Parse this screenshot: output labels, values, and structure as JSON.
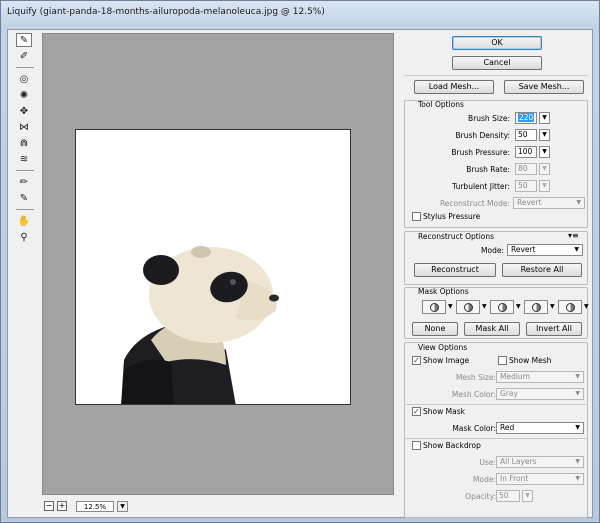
{
  "window": {
    "title": "Liquify (giant-panda-18-months-ailuropoda-melanoleuca.jpg @ 12.5%)"
  },
  "toolbar": {
    "tools": [
      {
        "name": "forward-warp",
        "glyph": "✎",
        "active": true
      },
      {
        "name": "reconstruct",
        "glyph": "✐"
      },
      {
        "name": "twirl",
        "glyph": "◎"
      },
      {
        "name": "pucker",
        "glyph": "✺"
      },
      {
        "name": "bloat",
        "glyph": "✥"
      },
      {
        "name": "push-left",
        "glyph": "⋈"
      },
      {
        "name": "mirror",
        "glyph": "⋒"
      },
      {
        "name": "turbulence",
        "glyph": "≋"
      },
      {
        "name": "freeze-mask",
        "glyph": "✏"
      },
      {
        "name": "thaw-mask",
        "glyph": "✎"
      },
      {
        "name": "hand",
        "glyph": "✋"
      },
      {
        "name": "zoom",
        "glyph": "⚲"
      }
    ]
  },
  "zoom": {
    "minus": "−",
    "plus": "+",
    "value": "12.5%",
    "caret": "▼"
  },
  "buttons": {
    "ok": "OK",
    "cancel": "Cancel",
    "load_mesh": "Load Mesh...",
    "save_mesh": "Save Mesh..."
  },
  "tool_options": {
    "title": "Tool Options",
    "brush_size_label": "Brush Size:",
    "brush_size": "220",
    "brush_density_label": "Brush Density:",
    "brush_density": "50",
    "brush_pressure_label": "Brush Pressure:",
    "brush_pressure": "100",
    "brush_rate_label": "Brush Rate:",
    "brush_rate": "80",
    "turbulent_jitter_label": "Turbulent Jitter:",
    "turbulent_jitter": "50",
    "reconstruct_mode_label": "Reconstruct Mode:",
    "reconstruct_mode": "Revert",
    "stylus_pressure": "Stylus Pressure",
    "caret": "▼"
  },
  "reconstruct_options": {
    "title": "Reconstruct Options",
    "mode_label": "Mode:",
    "mode": "Revert",
    "reconstruct": "Reconstruct",
    "restore_all": "Restore All",
    "menu_glyph": "▾≡"
  },
  "mask_options": {
    "title": "Mask Options",
    "none": "None",
    "mask_all": "Mask All",
    "invert_all": "Invert All"
  },
  "view_options": {
    "title": "View Options",
    "show_image": "Show Image",
    "show_image_checked": true,
    "show_mesh": "Show Mesh",
    "show_mesh_checked": false,
    "mesh_size_label": "Mesh Size:",
    "mesh_size": "Medium",
    "mesh_color_label": "Mesh Color:",
    "mesh_color": "Gray",
    "show_mask": "Show Mask",
    "show_mask_checked": true,
    "mask_color_label": "Mask Color:",
    "mask_color": "Red",
    "show_backdrop": "Show Backdrop",
    "show_backdrop_checked": false,
    "use_label": "Use:",
    "use": "All Layers",
    "mode_label": "Mode:",
    "mode": "In Front",
    "opacity_label": "Opacity:",
    "opacity": "50"
  },
  "check_glyph": "✓",
  "colors": {
    "canvas_bg": "#a3a3a3",
    "selection": "#3399ff"
  }
}
